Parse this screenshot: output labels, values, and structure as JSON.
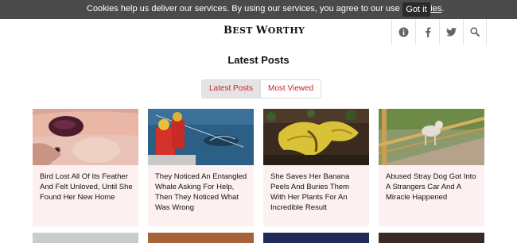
{
  "cookie_bar": {
    "text": "Cookies help us deliver our services. By using our services, you agree to our use of ",
    "link": "cookies",
    "after": ".",
    "button": "Got it"
  },
  "header": {
    "logo_first": "B",
    "logo_rest": "EST ",
    "logo_second": "W",
    "logo_rest2": "ORTHY",
    "icons": [
      "info-icon",
      "facebook-icon",
      "twitter-icon",
      "search-icon"
    ]
  },
  "page_title": "Latest Posts",
  "tabs": [
    {
      "label": "Latest Posts",
      "active": true
    },
    {
      "label": "Most Viewed",
      "active": false
    }
  ],
  "posts": [
    {
      "title": "Bird Lost All Of Its Feather And Felt Unloved, Until She Found Her New Home"
    },
    {
      "title": "They Noticed An Entangled Whale Asking For Help, Then They Noticed What Was Wrong"
    },
    {
      "title": "She Saves Her Banana Peels And Buries Them With Her Plants For An Incredible Result"
    },
    {
      "title": "Abused Stray Dog Got Into A Strangers Car And A Miracle Happened"
    }
  ],
  "colors": {
    "accent": "#c5272d",
    "card_bg": "#fcf1f0",
    "cookie_bg": "#4a4a4a"
  }
}
